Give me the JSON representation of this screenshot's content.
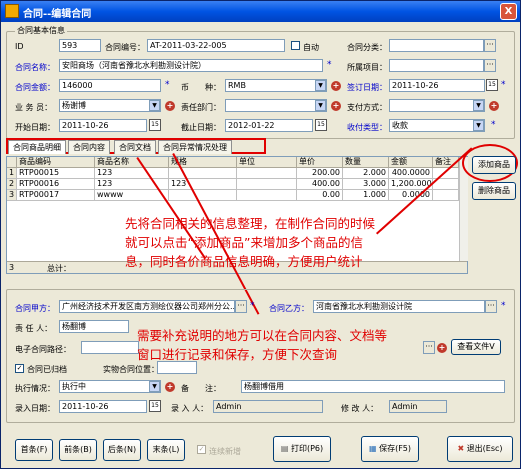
{
  "window": {
    "title": "合同--编辑合同",
    "close": "X"
  },
  "group_basic": {
    "legend": "合同基本信息"
  },
  "fields": {
    "id_label": "ID",
    "id_value": "593",
    "contract_no_label": "合同编号：",
    "contract_no_value": "AT-2011-03-22-005",
    "auto_label": "自动",
    "category_label": "合同分类：",
    "name_label": "合同名称：",
    "name_value": "安阳商场（河南省豫北水利勘测设计院）",
    "project_label": "所属项目：",
    "amount_label": "合同金额：",
    "amount_value": "146000",
    "currency_label": "币　　种：",
    "currency_value": "RMB",
    "sign_date_label": "签订日期：",
    "sign_date_value": "2011-10-26",
    "staff_label": "业 务 员：",
    "staff_value": "杨谢博",
    "dept_label": "责任部门：",
    "pay_label": "支付方式：",
    "start_label": "开始日期：",
    "start_value": "2011-10-26",
    "end_label": "截止日期：",
    "end_value": "2012-01-22",
    "receipt_label": "收付类型：",
    "receipt_value": "收款"
  },
  "tabs": [
    "合同商品明细",
    "合同内容",
    "合同文档",
    "合同异常情况处理"
  ],
  "grid": {
    "headers": [
      "商品编码",
      "商品名称",
      "规格",
      "单位",
      "单价",
      "数量",
      "金额",
      "备注"
    ],
    "rows": [
      {
        "no": "1",
        "code": "RTP00015",
        "name": "123",
        "spec": "",
        "unit": "",
        "price": "200.00",
        "qty": "2.000",
        "amount": "400.0000",
        "remark": ""
      },
      {
        "no": "2",
        "code": "RTP00016",
        "name": "123",
        "spec": "123",
        "unit": "",
        "price": "400.00",
        "qty": "3.000",
        "amount": "1,200.0000",
        "remark": ""
      },
      {
        "no": "3",
        "code": "RTP00017",
        "name": "wwww",
        "spec": "",
        "unit": "",
        "price": "0.00",
        "qty": "1.000",
        "amount": "0.0000",
        "remark": ""
      }
    ],
    "footer_no": "3",
    "footer_label": "总计："
  },
  "side_buttons": {
    "add": "添加商品",
    "delete": "删除商品"
  },
  "notes": {
    "line1": "先将合同相关的信息整理，在制作合同的时候",
    "line2": "就可以点击“添加商品”来增加多个商品的信",
    "line3": "息，同时各价商品信息明确，方便用户统计",
    "line4": "需要补充说明的地方可以在合同内容、文档等",
    "line5": "窗口进行记录和保存，方便下次查询"
  },
  "parties": {
    "a_label": "合同甲方：",
    "a_value": "广州经济技术开发区南方测绘仪器公司郑州分公...",
    "b_label": "合同乙方：",
    "b_value": "河南省豫北水利勘测设计院",
    "resp_label": "责 任 人：",
    "resp_value": "杨翻博",
    "epath_label": "电子合同路径：",
    "view_file": "查看文件V",
    "archived_label": "合同已归档",
    "location_label": "实物合同位置：",
    "exec_label": "执行情况：",
    "exec_value": "执行中",
    "memo_label": "备　　注：",
    "memo_value": "杨翻博借用",
    "entry_date_label": "录入日期：",
    "entry_date_value": "2011-10-26",
    "entry_by_label": "录 入 人：",
    "entry_by_value": "Admin",
    "modified_by_label": "修 改 人：",
    "modified_by_value": "Admin"
  },
  "bottom": {
    "first": "首条(F)",
    "prev": "前条(B)",
    "next": "后条(N)",
    "last": "末条(L)",
    "continuous": "连续新增",
    "print": "打印(P6)",
    "save": "保存(F5)",
    "exit": "退出(Esc)"
  },
  "colors": {
    "title": "#0054e3",
    "note": "#e00000",
    "label_blue": "#0000cc"
  }
}
